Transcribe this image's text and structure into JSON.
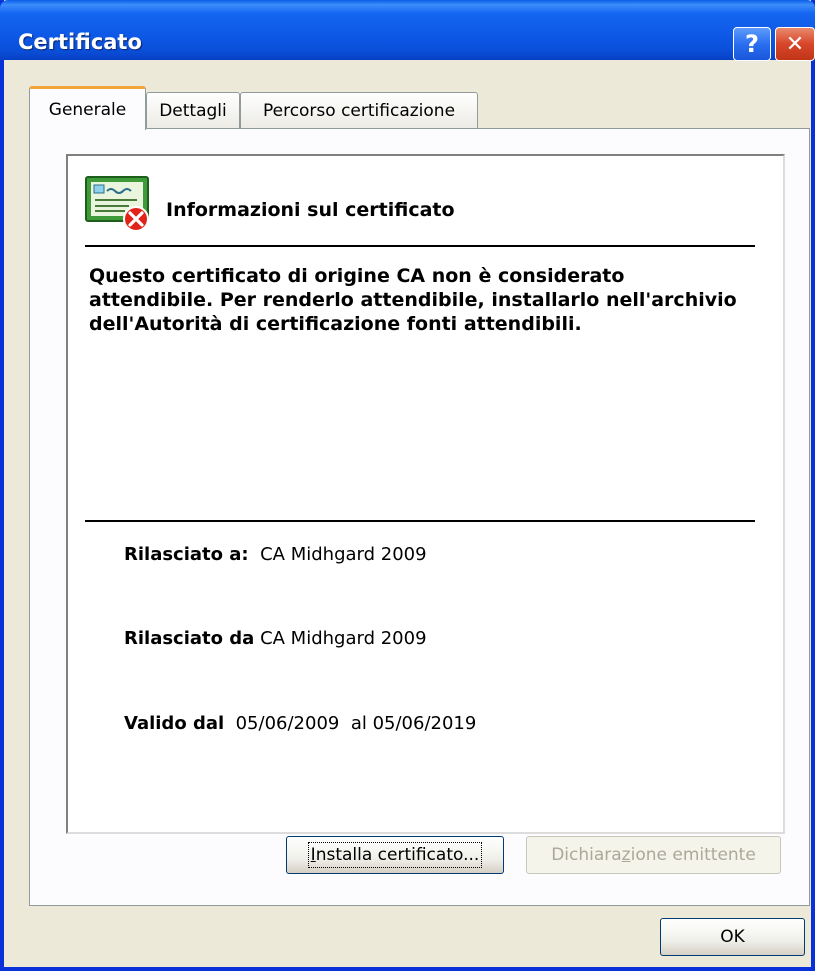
{
  "window": {
    "title": "Certificato",
    "help_glyph": "?",
    "close_glyph": "✕"
  },
  "tabs": [
    {
      "label": "Generale",
      "active": true
    },
    {
      "label": "Dettagli",
      "active": false
    },
    {
      "label": "Percorso certificazione",
      "active": false
    }
  ],
  "certificate": {
    "icon": "certificate-error-icon",
    "heading": "Informazioni sul certificato",
    "warning": "Questo certificato di origine CA non è considerato attendibile. Per renderlo attendibile, installarlo nell'archivio dell'Autorità di certificazione fonti attendibili.",
    "issued_to_label": "Rilasciato a:",
    "issued_to_value": "CA Midhgard 2009",
    "issued_by_label": "Rilasciato da",
    "issued_by_value": "CA Midhgard 2009",
    "valid_from_label": "Valido dal",
    "valid_from_value": "05/06/2009",
    "valid_to_label": "al",
    "valid_to_value": "05/06/2019"
  },
  "buttons": {
    "install_pre": "I",
    "install_rest": "nstalla certificato...",
    "issuer_statement_pre": "Dichiara",
    "issuer_statement_z": "z",
    "issuer_statement_rest": "ione emittente",
    "ok": "OK"
  },
  "colors": {
    "titlebar": "#0a5fe8",
    "window_bg": "#ece9d8",
    "active_tab_accent": "#f1a43a",
    "close_button": "#d8462a"
  }
}
